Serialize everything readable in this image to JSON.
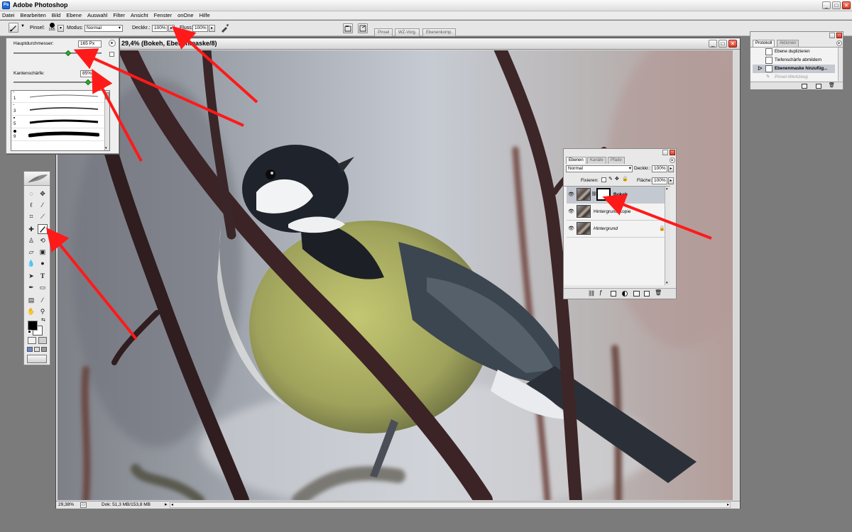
{
  "app": {
    "title": "Adobe Photoshop",
    "icon": "photoshop-icon"
  },
  "window_controls": {
    "minimize": "_",
    "maximize": "□",
    "close": "×"
  },
  "menu": [
    "Datei",
    "Bearbeiten",
    "Bild",
    "Ebene",
    "Auswahl",
    "Filter",
    "Ansicht",
    "Fenster",
    "onOne",
    "Hilfe"
  ],
  "options_bar": {
    "brush_label": "Pinsel:",
    "brush_size": "165",
    "mode_label": "Modus:",
    "mode_value": "Normal",
    "opacity_label": "Deckkr.:",
    "opacity_value": "100%",
    "flow_label": "Fluss:",
    "flow_value": "100%",
    "palette_tabs": [
      "Pinsel",
      "WZ-Vorg.",
      "Ebenenkomp."
    ]
  },
  "brush_popup": {
    "diameter_label": "Hauptdurchmesser:",
    "diameter_value": "165 Px",
    "diameter_level": 0.62,
    "hardness_label": "Kantenschärfe:",
    "hardness_value": "85%",
    "hardness_level": 0.85,
    "presets": [
      {
        "number": "1",
        "dot": 1
      },
      {
        "number": "3",
        "dot": 1
      },
      {
        "number": "5",
        "dot": 2
      },
      {
        "number": "9",
        "dot": 4
      }
    ]
  },
  "document": {
    "title": "29,4% (Bokeh, Ebenenmaske/8)",
    "zoom": "29,38%",
    "doc_info": "Dok: 51,3 MB/153,8 MB"
  },
  "layers_panel": {
    "tabs": [
      "Ebenen",
      "Kanäle",
      "Pfade"
    ],
    "blend_mode": "Normal",
    "opacity_label": "Deckkr.:",
    "opacity_value": "100%",
    "lock_label": "Fixieren:",
    "fill_label": "Fläche:",
    "fill_value": "100%",
    "layers": [
      {
        "name": "Bokeh",
        "has_mask": true,
        "selected": true,
        "locked": false
      },
      {
        "name": "Hintergrund Kopie",
        "has_mask": false,
        "selected": false,
        "locked": false
      },
      {
        "name": "Hintergrund",
        "has_mask": false,
        "selected": false,
        "locked": true
      }
    ]
  },
  "history_panel": {
    "tabs": [
      "Protokoll",
      "Aktionen"
    ],
    "items": [
      {
        "label": "Ebene duplizieren",
        "state": "normal"
      },
      {
        "label": "Tiefenschärfe abmildern",
        "state": "normal"
      },
      {
        "label": "Ebenenmaske hinzufüg...",
        "state": "current"
      },
      {
        "label": "Pinsel-Werkzeug",
        "state": "undone"
      }
    ]
  },
  "colors": {
    "annotation_arrow": "#ff1a1a",
    "foreground": "#000000",
    "background": "#ffffff",
    "brush_slider_thumb": "#2fae2f"
  }
}
